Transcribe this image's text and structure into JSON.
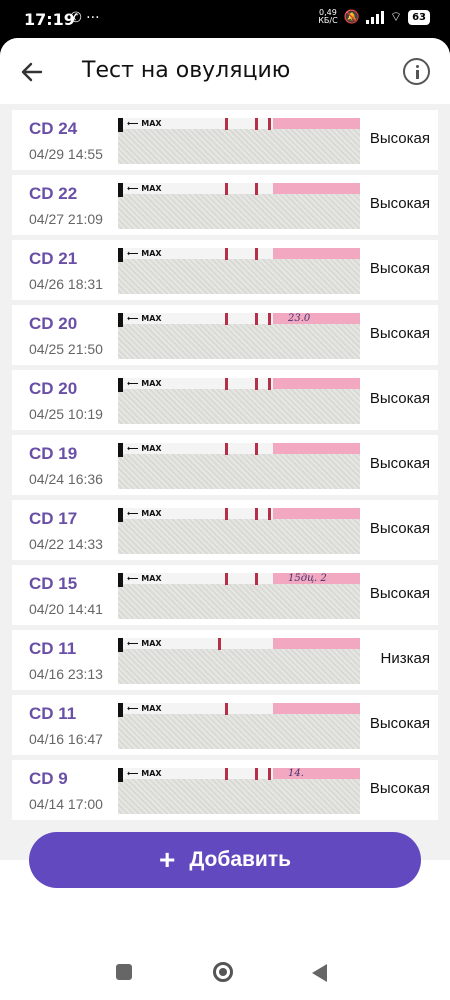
{
  "status_bar": {
    "time": "17:19",
    "left_icons": "✆ ···",
    "network_speed_top": "0,49",
    "network_speed_bottom": "КБ/С",
    "battery": "63"
  },
  "header": {
    "title": "Тест на овуляцию",
    "back_icon": "arrow-left-icon",
    "info_icon": "info-circle-icon"
  },
  "tests": [
    {
      "cd": "CD 24",
      "datetime": "04/29 14:55",
      "result": "Высокая",
      "note": ""
    },
    {
      "cd": "CD 22",
      "datetime": "04/27 21:09",
      "result": "Высокая",
      "note": ""
    },
    {
      "cd": "CD 21",
      "datetime": "04/26 18:31",
      "result": "Высокая",
      "note": ""
    },
    {
      "cd": "CD 20",
      "datetime": "04/25 21:50",
      "result": "Высокая",
      "note": "23.0"
    },
    {
      "cd": "CD 20",
      "datetime": "04/25 10:19",
      "result": "Высокая",
      "note": ""
    },
    {
      "cd": "CD 19",
      "datetime": "04/24 16:36",
      "result": "Высокая",
      "note": ""
    },
    {
      "cd": "CD 17",
      "datetime": "04/22 14:33",
      "result": "Высокая",
      "note": ""
    },
    {
      "cd": "CD 15",
      "datetime": "04/20 14:41",
      "result": "Высокая",
      "note": "15дц. 2"
    },
    {
      "cd": "CD 11",
      "datetime": "04/16 23:13",
      "result": "Низкая",
      "note": ""
    },
    {
      "cd": "CD 11",
      "datetime": "04/16 16:47",
      "result": "Высокая",
      "note": ""
    },
    {
      "cd": "CD 9",
      "datetime": "04/14 17:00",
      "result": "Высокая",
      "note": "14."
    }
  ],
  "strip_label": "MAX",
  "add_button": {
    "icon": "plus-icon",
    "label": "Добавить"
  },
  "colors": {
    "accent": "#6249bf",
    "cd_text": "#6a4fa6",
    "test_line": "#b43048"
  }
}
